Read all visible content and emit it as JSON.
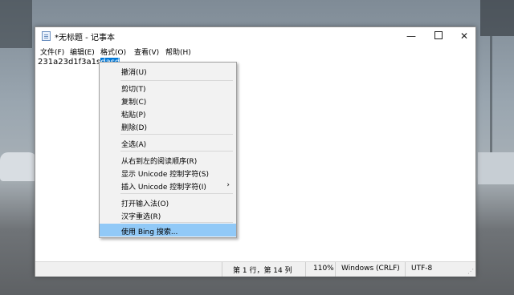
{
  "window": {
    "title": "*无标题 - 记事本",
    "minimize_glyph": "—",
    "close_glyph": "✕"
  },
  "menubar": [
    "文件(F)",
    "编辑(E)",
    "格式(O)",
    "查看(V)",
    "帮助(H)"
  ],
  "editor": {
    "text_before": "231a23d1f3a1s",
    "text_selected": "dasd"
  },
  "context_menu": {
    "groups": [
      [
        "撤消(U)"
      ],
      [
        "剪切(T)",
        "复制(C)",
        "粘贴(P)",
        "删除(D)"
      ],
      [
        "全选(A)"
      ],
      [
        "从右到左的阅读顺序(R)",
        "显示 Unicode 控制字符(S)",
        "插入 Unicode 控制字符(I)"
      ],
      [
        "打开输入法(O)",
        "汉字重选(R)"
      ],
      [
        "使用 Bing 搜索..."
      ]
    ],
    "submenu_arrow": "›",
    "highlighted": "使用 Bing 搜索..."
  },
  "statusbar": {
    "position": "第 1 行，第 14 列",
    "zoom": "110%",
    "line_ending": "Windows (CRLF)",
    "encoding": "UTF-8"
  },
  "colors": {
    "selection": "#0078d7",
    "menu_highlight": "#91c9f7"
  }
}
